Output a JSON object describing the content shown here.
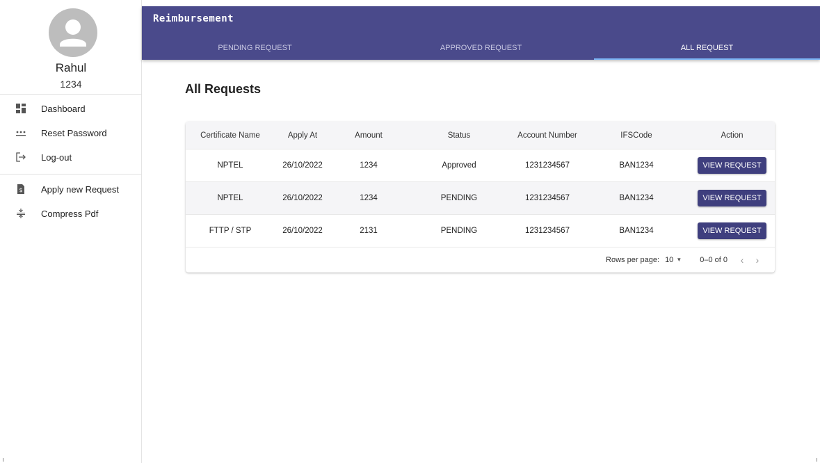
{
  "app": {
    "title": "Reimbursement"
  },
  "user": {
    "name": "Rahul",
    "id": "1234"
  },
  "sidebar": {
    "items": [
      {
        "label": "Dashboard",
        "icon": "dashboard-icon"
      },
      {
        "label": "Reset Password",
        "icon": "password-icon"
      },
      {
        "label": "Log-out",
        "icon": "logout-icon"
      },
      {
        "label": "Apply new Request",
        "icon": "file-dollar-icon"
      },
      {
        "label": "Compress Pdf",
        "icon": "compress-icon"
      }
    ]
  },
  "tabs": [
    {
      "label": "PENDING REQUEST",
      "active": false
    },
    {
      "label": "APPROVED REQUEST",
      "active": false
    },
    {
      "label": "ALL REQUEST",
      "active": true
    }
  ],
  "main": {
    "title": "All Requests",
    "table": {
      "headers": [
        "Certificate Name",
        "Apply At",
        "Amount",
        "Status",
        "Account Number",
        "IFSCode",
        "Action"
      ],
      "rows": [
        {
          "certificate": "NPTEL",
          "apply_at": "26/10/2022",
          "amount": "1234",
          "status": "Approved",
          "account": "1231234567",
          "ifsc": "BAN1234",
          "action": "VIEW REQUEST"
        },
        {
          "certificate": "NPTEL",
          "apply_at": "26/10/2022",
          "amount": "1234",
          "status": "PENDING",
          "account": "1231234567",
          "ifsc": "BAN1234",
          "action": "VIEW REQUEST"
        },
        {
          "certificate": "FTTP / STP",
          "apply_at": "26/10/2022",
          "amount": "2131",
          "status": "PENDING",
          "account": "1231234567",
          "ifsc": "BAN1234",
          "action": "VIEW REQUEST"
        }
      ]
    },
    "pagination": {
      "rows_per_page_label": "Rows per page:",
      "rows_per_page": "10",
      "range": "0–0 of 0",
      "prev": "‹",
      "next": "›"
    }
  },
  "colors": {
    "accent": "#4a4a8b",
    "button": "#3f3f7e",
    "tab_indicator": "#7ab3f5"
  }
}
